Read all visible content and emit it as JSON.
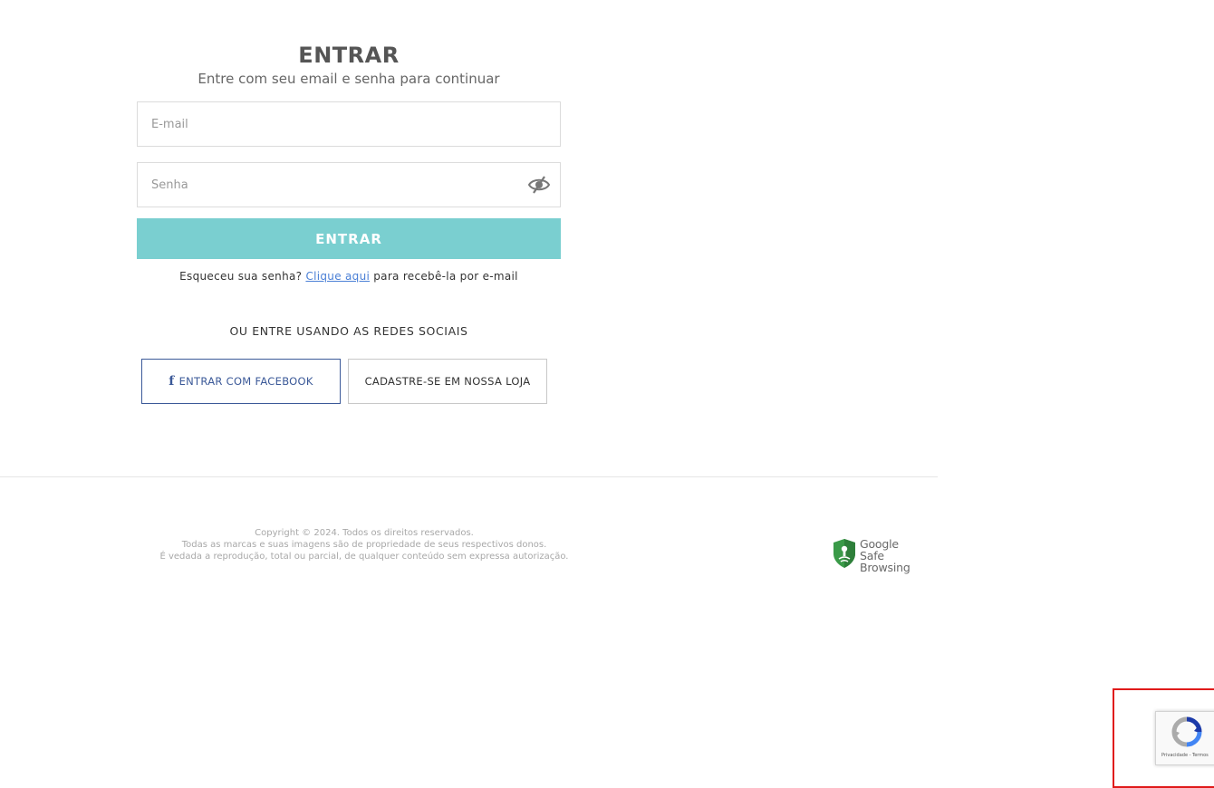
{
  "login": {
    "title": "ENTRAR",
    "subtitle": "Entre com seu email e senha para continuar",
    "email_placeholder": "E-mail",
    "password_placeholder": "Senha",
    "submit_label": "ENTRAR",
    "forgot_prefix": "Esqueceu sua senha?",
    "forgot_link": "Clique aqui",
    "forgot_suffix": "para recebê-la por e-mail",
    "social_title": "OU ENTRE USANDO AS REDES SOCIAIS",
    "facebook_icon": "f",
    "facebook_label": "ENTRAR COM FACEBOOK",
    "register_label": "CADASTRE-SE EM NOSSA LOJA"
  },
  "footer": {
    "copyright_lines": [
      "Copyright © 2024. Todos os direitos reservados.",
      "Todas as marcas e suas imagens são de propriedade de seus respectivos donos.",
      "É vedada a reprodução, total ou parcial, de qualquer conteúdo sem expressa autorização."
    ],
    "badge_line1": "Google",
    "badge_line2": "Safe Browsing"
  },
  "recaptcha": {
    "links": "Privacidade - Termos"
  },
  "colors": {
    "accent": "#7acfd0",
    "facebook": "#3b5998",
    "link": "#4a7fd6",
    "highlight_frame": "#e01a1a"
  },
  "icons": {
    "password_toggle": "eye-slash-icon",
    "facebook": "facebook-icon",
    "safe_browsing": "shield-icon",
    "recaptcha": "recaptcha-icon"
  }
}
